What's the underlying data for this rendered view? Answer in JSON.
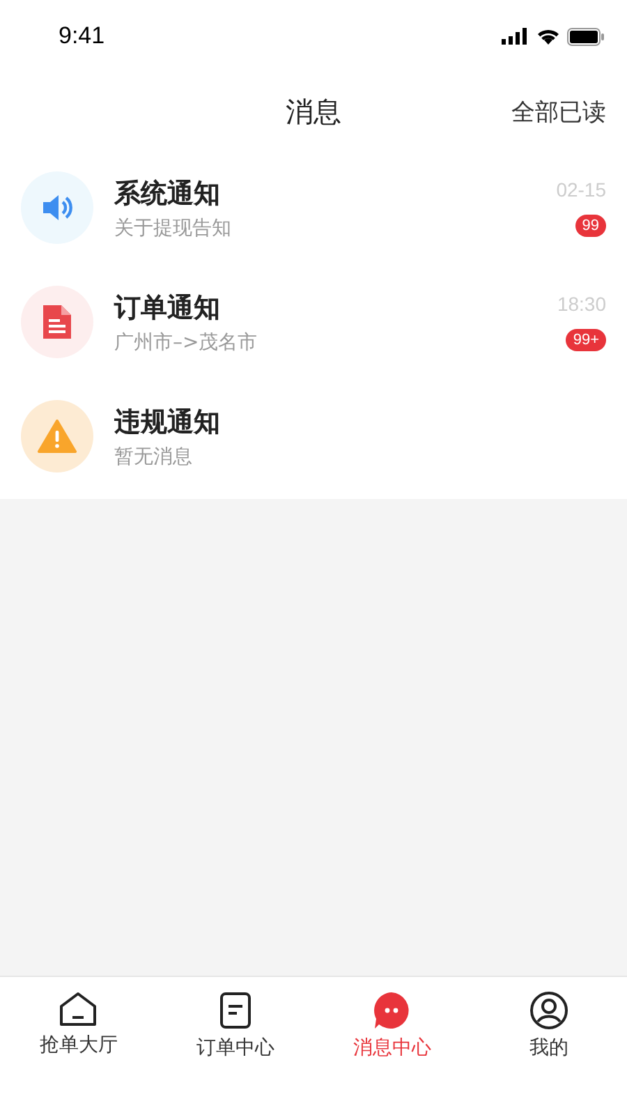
{
  "status_bar": {
    "time": "9:41"
  },
  "header": {
    "title": "消息",
    "action": "全部已读"
  },
  "messages": [
    {
      "kind": "system",
      "title": "系统通知",
      "preview": "关于提现告知",
      "time": "02-15",
      "badge": "99"
    },
    {
      "kind": "order",
      "title": "订单通知",
      "preview": "广州市–>茂名市",
      "time": "18:30",
      "badge": "99+"
    },
    {
      "kind": "violation",
      "title": "违规通知",
      "preview": "暂无消息"
    }
  ],
  "tab_bar": [
    {
      "kind": "home",
      "label": "抢单大厅",
      "selected": false
    },
    {
      "kind": "orders",
      "label": "订单中心",
      "selected": false
    },
    {
      "kind": "messages",
      "label": "消息中心",
      "selected": true
    },
    {
      "kind": "profile",
      "label": "我的",
      "selected": false
    }
  ]
}
